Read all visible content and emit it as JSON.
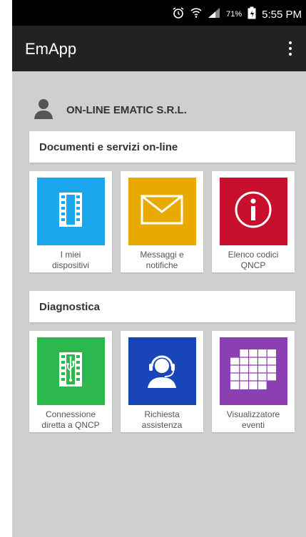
{
  "status": {
    "battery_pct": "71%",
    "time": "5:55 PM"
  },
  "appbar": {
    "title": "EmApp"
  },
  "company": {
    "name": "ON-LINE EMATIC S.R.L."
  },
  "sections": [
    {
      "title": "Documenti e servizi on-line",
      "tiles": [
        {
          "label": "I miei\ndispositivi",
          "icon": "device-list-icon",
          "color": "#1aa7ec"
        },
        {
          "label": "Messaggi e\nnotifiche",
          "icon": "envelope-icon",
          "color": "#e8a900"
        },
        {
          "label": "Elenco codici\nQNCP",
          "icon": "info-icon",
          "color": "#c8102e"
        }
      ]
    },
    {
      "title": "Diagnostica",
      "tiles": [
        {
          "label": "Connessione\ndiretta a QNCP",
          "icon": "usb-icon",
          "color": "#2db84d"
        },
        {
          "label": "Richiesta\nassistenza",
          "icon": "support-agent-icon",
          "color": "#1845b8"
        },
        {
          "label": "Visualizzatore\neventi",
          "icon": "calendar-icon",
          "color": "#8c3fb0"
        }
      ]
    }
  ]
}
